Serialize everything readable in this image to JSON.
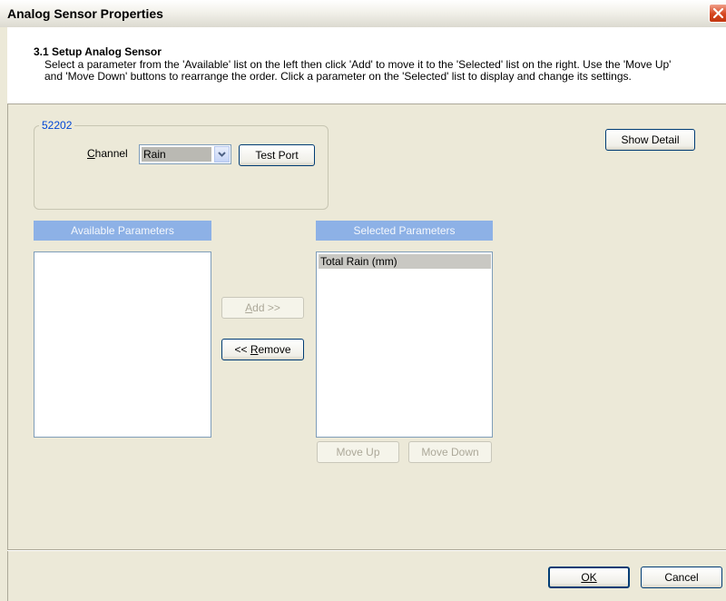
{
  "window": {
    "title": "Analog Sensor Properties"
  },
  "header": {
    "title": "3.1 Setup Analog Sensor",
    "desc_line1": "Select a parameter from the 'Available' list on the left then click 'Add' to move it to the 'Selected' list on the right.  Use the 'Move Up'",
    "desc_line2": "and 'Move Down' buttons to rearrange the order.  Click a parameter on the 'Selected' list to display and change its settings."
  },
  "group": {
    "legend": "52202"
  },
  "channel": {
    "label_key": "C",
    "label_rest": "hannel",
    "value": "Rain"
  },
  "buttons": {
    "test_port": "Test Port",
    "show_detail": "Show Detail",
    "add": "Add >>",
    "remove": "<< Remove",
    "move_up": "Move Up",
    "move_down": "Move Down",
    "ok": "OK",
    "cancel": "Cancel"
  },
  "available": {
    "header": "Available Parameters",
    "items": []
  },
  "selected": {
    "header": "Selected Parameters",
    "items": [
      "Total Rain (mm)"
    ]
  }
}
